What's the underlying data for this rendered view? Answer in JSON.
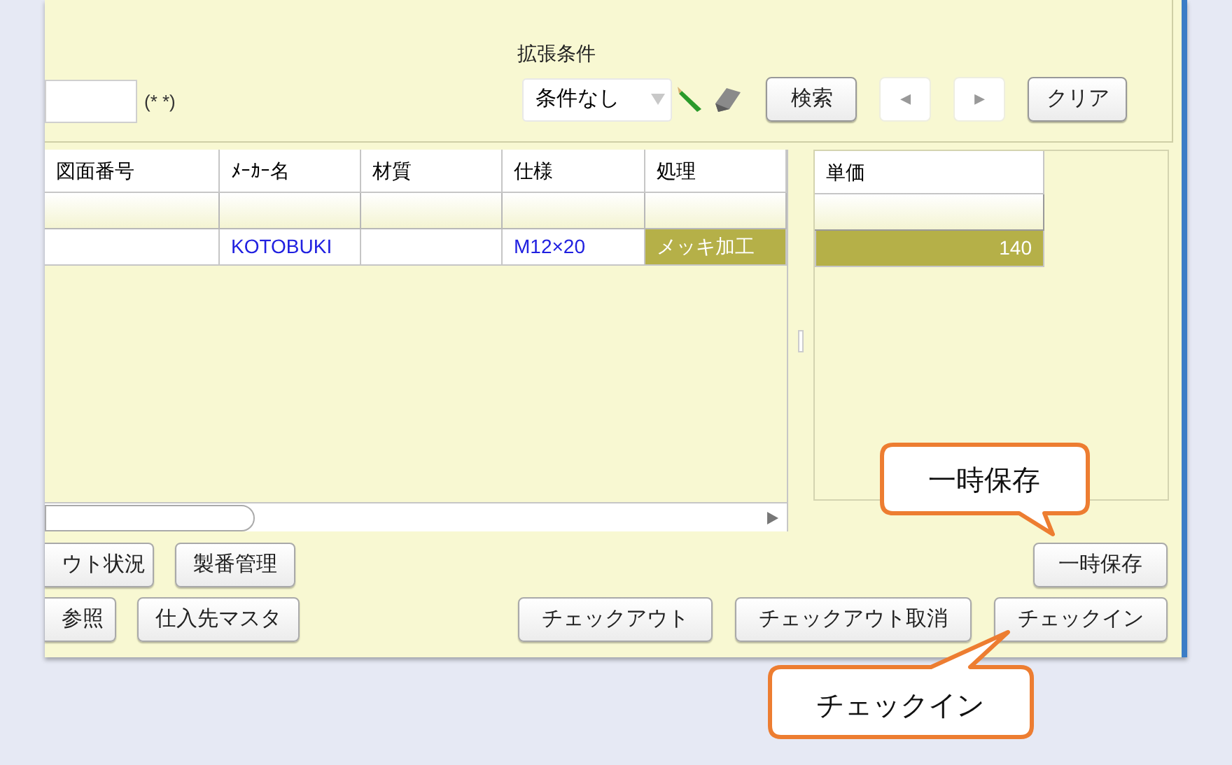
{
  "filter": {
    "label": "拡張条件",
    "hint": "(* *)",
    "condition": "条件なし"
  },
  "toolbar_buttons": [
    {
      "label": "検索",
      "disabled": false
    },
    {
      "label": "◂",
      "disabled": true
    },
    {
      "label": "▸",
      "disabled": true
    },
    {
      "label": "クリア",
      "disabled": false
    }
  ],
  "grid": {
    "columns": [
      "図面番号",
      "ﾒｰｶｰ名",
      "材質",
      "仕様",
      "処理"
    ],
    "rows": [
      [
        {
          "kind": "plain"
        },
        {
          "kind": "link",
          "text": "KOTOBUKI"
        },
        {
          "kind": "plain"
        },
        {
          "kind": "link",
          "text": "M12×20"
        },
        {
          "kind": "highlight",
          "text": "メッキ加工"
        }
      ]
    ]
  },
  "price_grid": {
    "columns": [
      "単価"
    ],
    "rows": [
      [
        {
          "kind": "highlight",
          "text": "140"
        }
      ]
    ]
  },
  "buttons_row1": {
    "left": [
      "ウト状況",
      "製番管理"
    ],
    "right": [
      "一時保存"
    ]
  },
  "buttons_row2": {
    "left": [
      "参照",
      "仕入先マスタ"
    ],
    "right": [
      "チェックアウト",
      "チェックアウト取消",
      "チェックイン"
    ]
  },
  "callouts": [
    {
      "text": "一時保存"
    },
    {
      "text": "チェックイン"
    }
  ]
}
